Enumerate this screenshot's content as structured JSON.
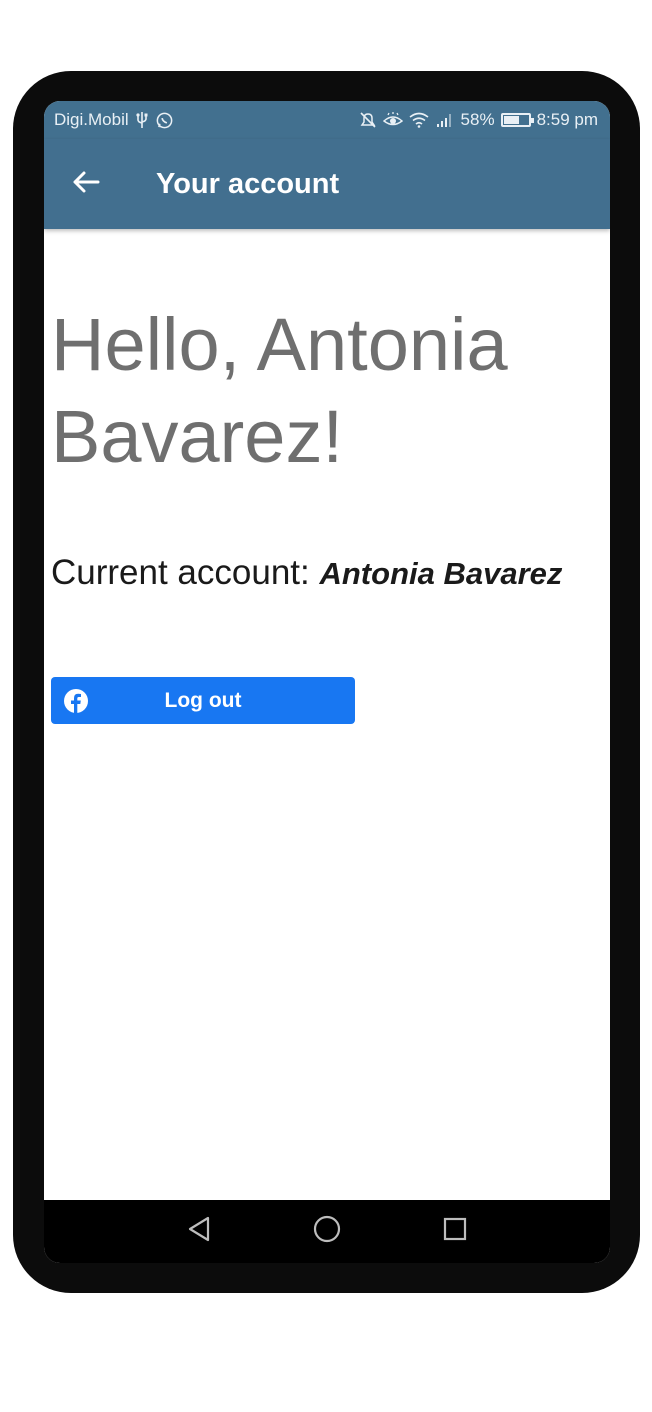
{
  "status_bar": {
    "carrier": "Digi.Mobil",
    "battery_percent": "58%",
    "battery_level": 0.58,
    "time": "8:59 pm",
    "icons_left": [
      "usb-icon",
      "whatsapp-icon"
    ],
    "icons_right": [
      "mute-icon",
      "eye-comfort-icon",
      "wifi-icon",
      "signal-icon",
      "battery-icon"
    ]
  },
  "app_bar": {
    "title": "Your account",
    "back_icon": "arrow-left-icon",
    "color": "#426f8f"
  },
  "main": {
    "greeting": "Hello, Antonia Bavarez!",
    "current_account_label": "Current account:",
    "current_account_name": "Antonia Bavarez",
    "logout_button": {
      "label": "Log out",
      "icon": "facebook-icon",
      "color": "#1877f2"
    }
  },
  "nav_bar": {
    "buttons": [
      "back-triangle-icon",
      "home-circle-icon",
      "recents-square-icon"
    ]
  }
}
